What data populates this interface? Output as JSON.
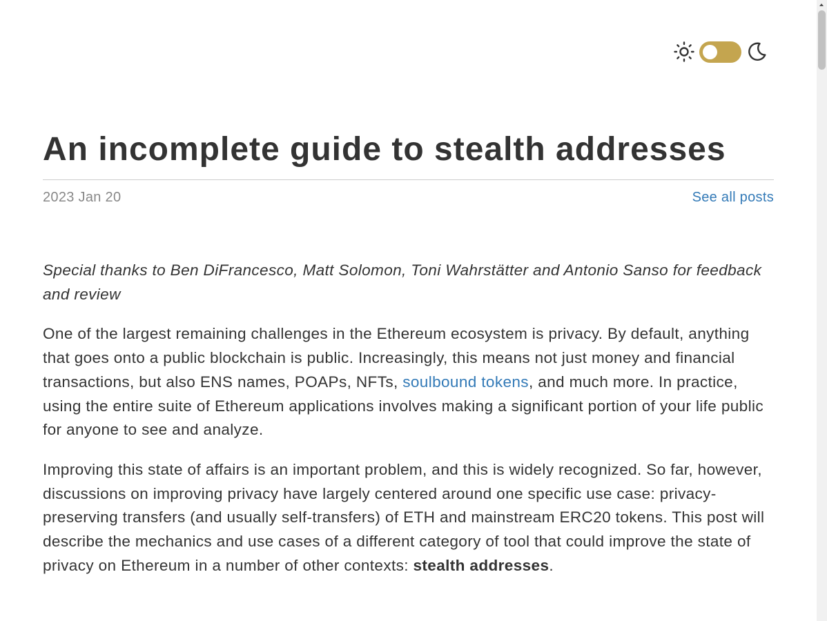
{
  "theme_toggle": {
    "sun_icon": "sun-icon",
    "moon_icon": "moon-icon",
    "switch_color": "#c4a54f",
    "mode": "light"
  },
  "post": {
    "title": "An incomplete guide to stealth addresses",
    "date": "2023 Jan 20",
    "see_all_posts": "See all posts"
  },
  "body": {
    "thanks": "Special thanks to Ben DiFrancesco, Matt Solomon, Toni Wahrstätter and Antonio Sanso for feedback and review",
    "p1_before": "One of the largest remaining challenges in the Ethereum ecosystem is privacy. By default, anything that goes onto a public blockchain is public. Increasingly, this means not just money and financial transactions, but also ENS names, POAPs, NFTs, ",
    "p1_link": "soulbound tokens",
    "p1_after": ", and much more. In practice, using the entire suite of Ethereum applications involves making a significant portion of your life public for anyone to see and analyze.",
    "p2_before": "Improving this state of affairs is an important problem, and this is widely recognized. So far, however, discussions on improving privacy have largely centered around one specific use case: privacy-preserving transfers (and usually self-transfers) of ETH and mainstream ERC20 tokens. This post will describe the mechanics and use cases of a different category of tool that could improve the state of privacy on Ethereum in a number of other contexts: ",
    "p2_bold": "stealth addresses",
    "p2_after": "."
  },
  "colors": {
    "text": "#333333",
    "muted": "#888888",
    "link": "#337ab7",
    "accent": "#c4a54f"
  }
}
